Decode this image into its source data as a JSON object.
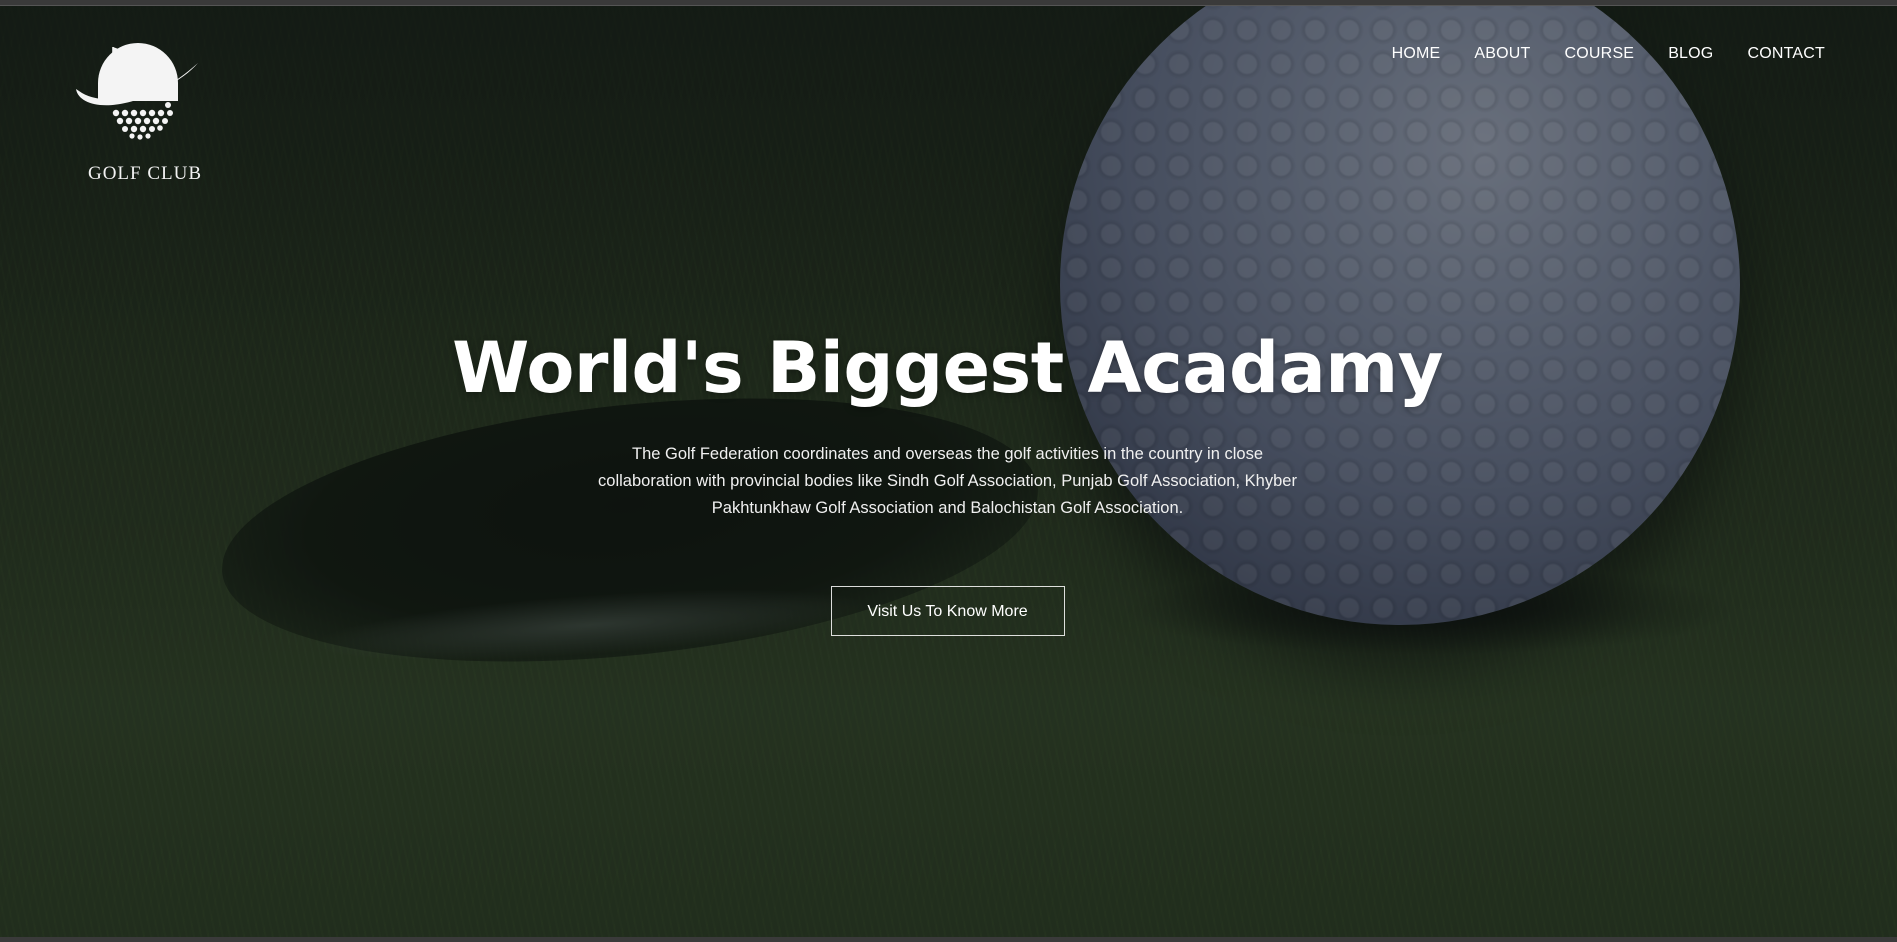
{
  "brand": {
    "logo_text": "GOLF CLUB",
    "logo_icon": "golf-ball-flag-icon"
  },
  "nav": {
    "items": [
      {
        "label": "HOME"
      },
      {
        "label": "ABOUT"
      },
      {
        "label": "COURSE"
      },
      {
        "label": "BLOG"
      },
      {
        "label": "CONTACT"
      }
    ]
  },
  "hero": {
    "title": "World's Biggest Acadamy",
    "description": "The Golf Federation coordinates and overseas the golf activities in the country in close collaboration with provincial bodies like Sindh Golf Association, Punjab Golf Association, Khyber Pakhtunkhaw Golf Association and Balochistan Golf Association.",
    "cta_label": "Visit Us To Know More"
  },
  "colors": {
    "text": "#ffffff",
    "overlay": "#0f1419",
    "grass": "#2c3b1f"
  }
}
